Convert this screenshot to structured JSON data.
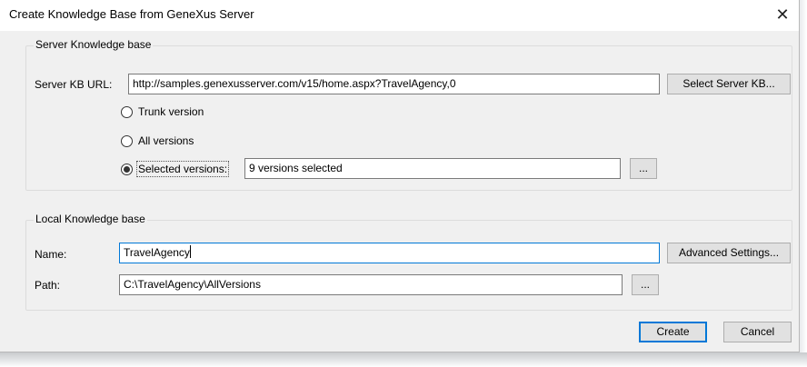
{
  "dialog": {
    "title": "Create Knowledge Base from GeneXus Server",
    "close_glyph": "✕"
  },
  "server_group": {
    "legend": "Server Knowledge base",
    "url_label": "Server KB URL:",
    "url_value": "http://samples.genexusserver.com/v15/home.aspx?TravelAgency,0",
    "select_button": "Select Server KB...",
    "radios": [
      {
        "label": "Trunk version",
        "checked": false
      },
      {
        "label": "All versions",
        "checked": false
      },
      {
        "label": "Selected versions:",
        "checked": true
      }
    ],
    "selected_versions_value": "9 versions selected",
    "browse_button": "..."
  },
  "local_group": {
    "legend": "Local Knowledge base",
    "name_label": "Name:",
    "name_value": "TravelAgency",
    "advanced_button": "Advanced Settings...",
    "path_label": "Path:",
    "path_value": "C:\\TravelAgency\\AllVersions",
    "browse_button": "..."
  },
  "footer": {
    "create_button": "Create",
    "cancel_button": "Cancel"
  },
  "colors": {
    "dialog_bg": "#f0f0f0",
    "accent": "#0078d7",
    "button_bg": "#e1e1e1"
  }
}
